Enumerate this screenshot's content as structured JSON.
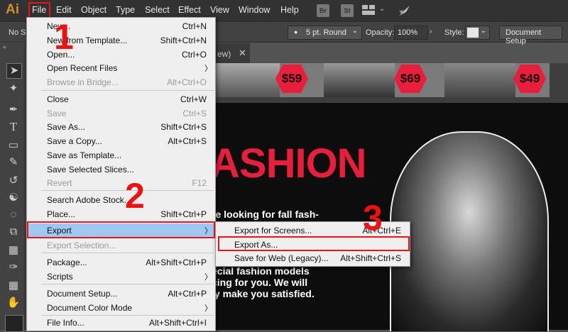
{
  "app": {
    "logo": "Ai"
  },
  "menubar": {
    "items": [
      "File",
      "Edit",
      "Object",
      "Type",
      "Select",
      "Effect",
      "View",
      "Window",
      "Help"
    ],
    "icons": [
      "Br",
      "St"
    ]
  },
  "control_bar": {
    "left_label": "No Se",
    "stroke_profile": "5 pt. Round",
    "opacity_label": "Opacity:",
    "opacity_value": "100%",
    "style_label": "Style:",
    "document_setup": "Document Setup"
  },
  "doc": {
    "tab_text": "ew)",
    "prices": [
      "$59",
      "$69",
      "$49"
    ],
    "hero_title": "ASHION",
    "hero_lines": [
      "re looking for fall fash-",
      "ecial fashion models",
      "cing for you. We will",
      "ly make you satisfied."
    ]
  },
  "file_menu": {
    "items": [
      {
        "label": "New...",
        "shortcut": "Ctrl+N"
      },
      {
        "label": "New from Template...",
        "shortcut": "Shift+Ctrl+N"
      },
      {
        "label": "Open...",
        "shortcut": "Ctrl+O"
      },
      {
        "label": "Open Recent Files",
        "shortcut": "",
        "submenu": true
      },
      {
        "label": "Browse in Bridge...",
        "shortcut": "Alt+Ctrl+O",
        "disabled": true
      },
      {
        "label": "Close",
        "shortcut": "Ctrl+W"
      },
      {
        "label": "Save",
        "shortcut": "Ctrl+S",
        "disabled": true
      },
      {
        "label": "Save As...",
        "shortcut": "Shift+Ctrl+S"
      },
      {
        "label": "Save a Copy...",
        "shortcut": "Alt+Ctrl+S"
      },
      {
        "label": "Save as Template...",
        "shortcut": ""
      },
      {
        "label": "Save Selected Slices...",
        "shortcut": ""
      },
      {
        "label": "Revert",
        "shortcut": "F12",
        "disabled": true
      },
      {
        "label": "Search Adobe Stock...",
        "shortcut": ""
      },
      {
        "label": "Place...",
        "shortcut": "Shift+Ctrl+P"
      },
      {
        "label": "Export",
        "shortcut": "",
        "submenu": true,
        "highlighted": true
      },
      {
        "label": "Export Selection...",
        "shortcut": "",
        "disabled": true
      },
      {
        "label": "Package...",
        "shortcut": "Alt+Shift+Ctrl+P"
      },
      {
        "label": "Scripts",
        "shortcut": "",
        "submenu": true
      },
      {
        "label": "Document Setup...",
        "shortcut": "Alt+Ctrl+P"
      },
      {
        "label": "Document Color Mode",
        "shortcut": "",
        "submenu": true
      },
      {
        "label": "File Info...",
        "shortcut": "Alt+Shift+Ctrl+I"
      }
    ]
  },
  "export_menu": {
    "items": [
      {
        "label": "Export for Screens...",
        "shortcut": "Alt+Ctrl+E"
      },
      {
        "label": "Export As...",
        "shortcut": ""
      },
      {
        "label": "Save for Web (Legacy)...",
        "shortcut": "Alt+Shift+Ctrl+S"
      }
    ]
  },
  "annotations": {
    "step1": "1",
    "step2": "2",
    "step3": "3"
  },
  "colors": {
    "annotation": "#e11111",
    "highlight": "#9ec9f2",
    "accent_red": "#e81e3c"
  }
}
